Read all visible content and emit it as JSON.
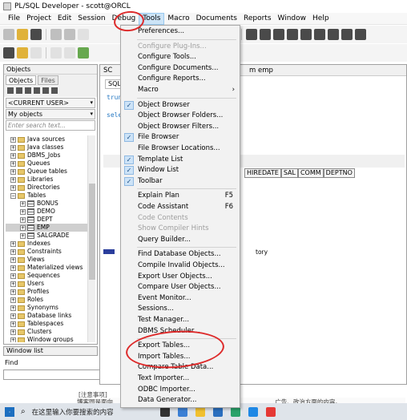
{
  "window": {
    "title": "PL/SQL Developer - scott@ORCL"
  },
  "menubar": [
    "File",
    "Project",
    "Edit",
    "Session",
    "Debug",
    "Tools",
    "Macro",
    "Documents",
    "Reports",
    "Window",
    "Help"
  ],
  "tools_menu": {
    "items": [
      {
        "label": "Preferences...",
        "disabled": false,
        "checked": false,
        "shortcut": "",
        "submenu": false
      },
      {
        "label": "Configure Plug-Ins...",
        "disabled": true,
        "checked": false,
        "shortcut": "",
        "submenu": false
      },
      {
        "label": "Configure Tools...",
        "disabled": false,
        "checked": false,
        "shortcut": "",
        "submenu": false
      },
      {
        "label": "Configure Documents...",
        "disabled": false,
        "checked": false,
        "shortcut": "",
        "submenu": false
      },
      {
        "label": "Configure Reports...",
        "disabled": false,
        "checked": false,
        "shortcut": "",
        "submenu": false
      },
      {
        "label": "Macro",
        "disabled": false,
        "checked": false,
        "shortcut": "",
        "submenu": true
      },
      {
        "label": "Object Browser",
        "disabled": false,
        "checked": true,
        "shortcut": "",
        "submenu": false
      },
      {
        "label": "Object Browser Folders...",
        "disabled": false,
        "checked": false,
        "shortcut": "",
        "submenu": false
      },
      {
        "label": "Object Browser Filters...",
        "disabled": false,
        "checked": false,
        "shortcut": "",
        "submenu": false
      },
      {
        "label": "File Browser",
        "disabled": false,
        "checked": true,
        "shortcut": "",
        "submenu": false
      },
      {
        "label": "File Browser Locations...",
        "disabled": false,
        "checked": false,
        "shortcut": "",
        "submenu": false
      },
      {
        "label": "Template List",
        "disabled": false,
        "checked": true,
        "shortcut": "",
        "submenu": false
      },
      {
        "label": "Window List",
        "disabled": false,
        "checked": true,
        "shortcut": "",
        "submenu": false
      },
      {
        "label": "Toolbar",
        "disabled": false,
        "checked": true,
        "shortcut": "",
        "submenu": false
      },
      {
        "label": "Explain Plan",
        "disabled": false,
        "checked": false,
        "shortcut": "F5",
        "submenu": false
      },
      {
        "label": "Code Assistant",
        "disabled": false,
        "checked": false,
        "shortcut": "F6",
        "submenu": false
      },
      {
        "label": "Code Contents",
        "disabled": true,
        "checked": false,
        "shortcut": "",
        "submenu": false
      },
      {
        "label": "Show Compiler Hints",
        "disabled": true,
        "checked": false,
        "shortcut": "",
        "submenu": false
      },
      {
        "label": "Query Builder...",
        "disabled": false,
        "checked": false,
        "shortcut": "",
        "submenu": false
      },
      {
        "label": "Find Database Objects...",
        "disabled": false,
        "checked": false,
        "shortcut": "",
        "submenu": false
      },
      {
        "label": "Compile Invalid Objects...",
        "disabled": false,
        "checked": false,
        "shortcut": "",
        "submenu": false
      },
      {
        "label": "Export User Objects...",
        "disabled": false,
        "checked": false,
        "shortcut": "",
        "submenu": false
      },
      {
        "label": "Compare User Objects...",
        "disabled": false,
        "checked": false,
        "shortcut": "",
        "submenu": false
      },
      {
        "label": "Event Monitor...",
        "disabled": false,
        "checked": false,
        "shortcut": "",
        "submenu": false
      },
      {
        "label": "Sessions...",
        "disabled": false,
        "checked": false,
        "shortcut": "",
        "submenu": false
      },
      {
        "label": "Test Manager...",
        "disabled": false,
        "checked": false,
        "shortcut": "",
        "submenu": false
      },
      {
        "label": "DBMS Scheduler...",
        "disabled": false,
        "checked": false,
        "shortcut": "",
        "submenu": false
      },
      {
        "label": "Export Tables...",
        "disabled": false,
        "checked": false,
        "shortcut": "",
        "submenu": false
      },
      {
        "label": "Import Tables...",
        "disabled": false,
        "checked": false,
        "shortcut": "",
        "submenu": false
      },
      {
        "label": "Compare Table Data...",
        "disabled": false,
        "checked": false,
        "shortcut": "",
        "submenu": false
      },
      {
        "label": "Text Importer...",
        "disabled": false,
        "checked": false,
        "shortcut": "",
        "submenu": false
      },
      {
        "label": "ODBC Importer...",
        "disabled": false,
        "checked": false,
        "shortcut": "",
        "submenu": false
      },
      {
        "label": "Data Generator...",
        "disabled": false,
        "checked": false,
        "shortcut": "",
        "submenu": false
      }
    ]
  },
  "objects_panel": {
    "title": "Objects",
    "tabs": [
      "Objects",
      "Files"
    ],
    "user_select": "<CURRENT USER>",
    "filter_select": "My objects",
    "search_placeholder": "Enter search text...",
    "tree": [
      {
        "label": "Java sources",
        "kind": "folder",
        "expanded": false,
        "level": 0
      },
      {
        "label": "Java classes",
        "kind": "folder",
        "expanded": false,
        "level": 0
      },
      {
        "label": "DBMS_Jobs",
        "kind": "folder",
        "expanded": false,
        "level": 0
      },
      {
        "label": "Queues",
        "kind": "folder",
        "expanded": false,
        "level": 0
      },
      {
        "label": "Queue tables",
        "kind": "folder",
        "expanded": false,
        "level": 0
      },
      {
        "label": "Libraries",
        "kind": "folder",
        "expanded": false,
        "level": 0
      },
      {
        "label": "Directories",
        "kind": "folder",
        "expanded": false,
        "level": 0
      },
      {
        "label": "Tables",
        "kind": "folder",
        "expanded": true,
        "level": 0
      },
      {
        "label": "BONUS",
        "kind": "table",
        "expanded": false,
        "level": 1
      },
      {
        "label": "DEMO",
        "kind": "table",
        "expanded": false,
        "level": 1
      },
      {
        "label": "DEPT",
        "kind": "table",
        "expanded": false,
        "level": 1
      },
      {
        "label": "EMP",
        "kind": "table",
        "expanded": false,
        "level": 1,
        "selected": true
      },
      {
        "label": "SALGRADE",
        "kind": "table",
        "expanded": false,
        "level": 1
      },
      {
        "label": "Indexes",
        "kind": "folder",
        "expanded": false,
        "level": 0
      },
      {
        "label": "Constraints",
        "kind": "folder",
        "expanded": false,
        "level": 0
      },
      {
        "label": "Views",
        "kind": "folder",
        "expanded": false,
        "level": 0
      },
      {
        "label": "Materialized views",
        "kind": "folder",
        "expanded": false,
        "level": 0
      },
      {
        "label": "Sequences",
        "kind": "folder",
        "expanded": false,
        "level": 0
      },
      {
        "label": "Users",
        "kind": "folder",
        "expanded": false,
        "level": 0
      },
      {
        "label": "Profiles",
        "kind": "folder",
        "expanded": false,
        "level": 0
      },
      {
        "label": "Roles",
        "kind": "folder",
        "expanded": false,
        "level": 0
      },
      {
        "label": "Synonyms",
        "kind": "folder",
        "expanded": false,
        "level": 0
      },
      {
        "label": "Database links",
        "kind": "folder",
        "expanded": false,
        "level": 0
      },
      {
        "label": "Tablespaces",
        "kind": "folder",
        "expanded": false,
        "level": 0
      },
      {
        "label": "Clusters",
        "kind": "folder",
        "expanded": false,
        "level": 0
      },
      {
        "label": "Window groups",
        "kind": "folder",
        "expanded": false,
        "level": 0
      }
    ]
  },
  "window_list": {
    "title": "Window list"
  },
  "find": {
    "label": "Find"
  },
  "editor": {
    "title": "SC",
    "title_right": "m emp",
    "tab": "SQL",
    "code_line1": "trun",
    "code_line2": "sele",
    "columns": [
      "HIREDATE",
      "SAL",
      "COMM",
      "DEPTNO"
    ],
    "status_text": "tory"
  },
  "background_text": {
    "line1": "[注意事项]",
    "line2": "博客园是面向",
    "line3": "广告、政治方面的内容。"
  },
  "taskbar": {
    "search_placeholder": "在这里输入你要搜索的内容"
  }
}
